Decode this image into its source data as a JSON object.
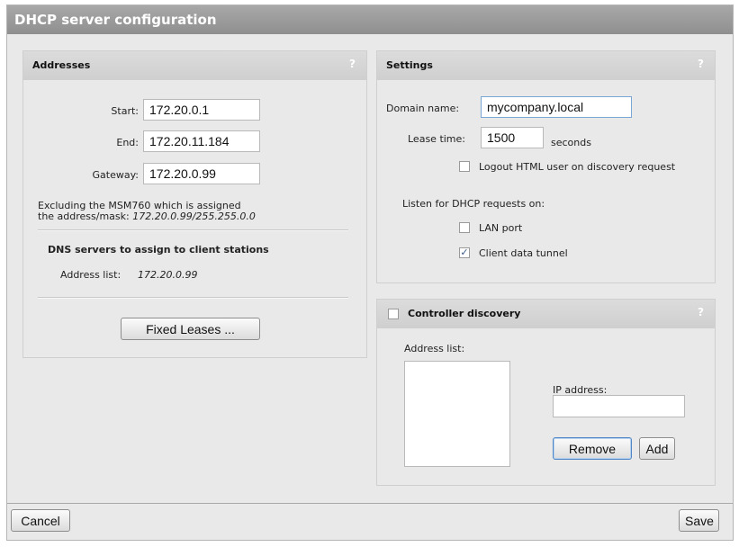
{
  "window": {
    "title": "DHCP server configuration"
  },
  "addresses": {
    "heading": "Addresses",
    "help": "?",
    "start_label": "Start:",
    "start_value": "172.20.0.1",
    "end_label": "End:",
    "end_value": "172.20.11.184",
    "gateway_label": "Gateway:",
    "gateway_value": "172.20.0.99",
    "excluding_line1": "Excluding the MSM760 which is assigned",
    "excluding_line2_prefix": "the address/mask: ",
    "excluding_mask": "172.20.0.99/255.255.0.0",
    "dns_heading": "DNS servers to assign to client stations",
    "dns_label": "Address list:",
    "dns_value": "172.20.0.99",
    "fixed_leases_button": "Fixed Leases ..."
  },
  "settings": {
    "heading": "Settings",
    "help": "?",
    "domain_label": "Domain name:",
    "domain_value": "mycompany.local",
    "lease_label": "Lease time:",
    "lease_value": "1500",
    "lease_unit": "seconds",
    "logout_label": "Logout HTML user on discovery request",
    "logout_checked": false,
    "listen_label": "Listen for DHCP requests on:",
    "lan_label": "LAN port",
    "lan_checked": false,
    "tunnel_label": "Client data tunnel",
    "tunnel_checked": true,
    "check_glyph": "✓"
  },
  "discovery": {
    "heading": "Controller discovery",
    "help": "?",
    "enabled": false,
    "address_list_label": "Address list:",
    "ip_label": "IP address:",
    "ip_value": "",
    "remove_button": "Remove",
    "add_button": "Add"
  },
  "footer": {
    "cancel_button": "Cancel",
    "save_button": "Save"
  }
}
